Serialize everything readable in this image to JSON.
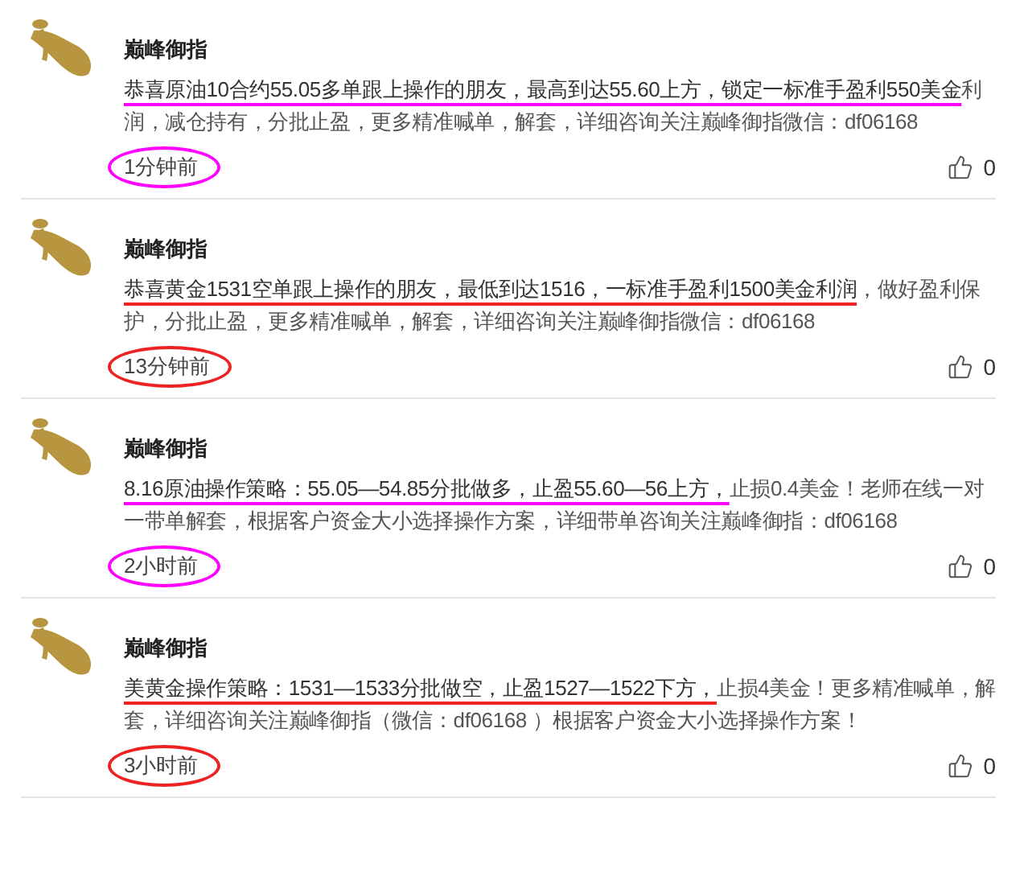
{
  "posts": [
    {
      "author": "巅峰御指",
      "marked": "恭喜原油10合约55.05多单跟上操作的朋友，最高到达55.60上方，锁定一标准手盈利550美金",
      "rest": "利润，减仓持有，分批止盈，更多精准喊单，解套，详细咨询关注巅峰御指微信：df06168",
      "time": "1分钟前",
      "likes": "0",
      "color": "#ff00ff"
    },
    {
      "author": "巅峰御指",
      "marked": "恭喜黄金1531空单跟上操作的朋友，最低到达1516，一标准手盈利1500美金利润",
      "rest": "，做好盈利保护，分批止盈，更多精准喊单，解套，详细咨询关注巅峰御指微信：df06168",
      "time": "13分钟前",
      "likes": "0",
      "color": "#ee2222"
    },
    {
      "author": "巅峰御指",
      "marked": "8.16原油操作策略：55.05—54.85分批做多，止盈55.60—56上方，",
      "rest": "止损0.4美金！老师在线一对一带单解套，根据客户资金大小选择操作方案，详细带单咨询关注巅峰御指：df06168",
      "time": "2小时前",
      "likes": "0",
      "color": "#ff00ff"
    },
    {
      "author": "巅峰御指",
      "marked": "美黄金操作策略：1531—1533分批做空，止盈1527—1522下方，",
      "rest": "止损4美金！更多精准喊单，解套，详细咨询关注巅峰御指（微信：df06168 ）根据客户资金大小选择操作方案！",
      "time": "3小时前",
      "likes": "0",
      "color": "#ee2222"
    }
  ]
}
